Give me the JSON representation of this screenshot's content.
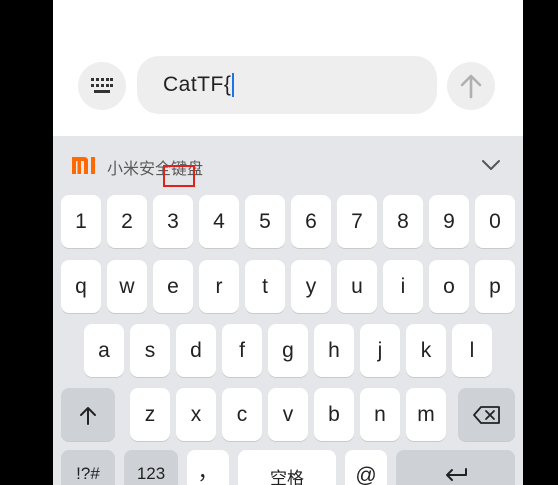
{
  "input": {
    "value": "CatTF{"
  },
  "keyboard": {
    "title": "小米安全键盘",
    "rows": {
      "numbers": [
        "1",
        "2",
        "3",
        "4",
        "5",
        "6",
        "7",
        "8",
        "9",
        "0"
      ],
      "row1": [
        "q",
        "w",
        "e",
        "r",
        "t",
        "y",
        "u",
        "i",
        "o",
        "p"
      ],
      "row2": [
        "a",
        "s",
        "d",
        "f",
        "g",
        "h",
        "j",
        "k",
        "l"
      ],
      "row3": [
        "z",
        "x",
        "c",
        "v",
        "b",
        "n",
        "m"
      ]
    },
    "bottom": {
      "symbols": "!?#",
      "numbers": "123",
      "comma": "，",
      "space": "空格",
      "at": "@"
    }
  },
  "colors": {
    "brand": "#ff6900",
    "caret": "#1a73e8",
    "highlight": "#e0211c"
  },
  "icons": [
    "keyboard-icon",
    "arrow-up-icon",
    "xiaomi-logo",
    "chevron-down-icon",
    "shift-icon",
    "backspace-icon",
    "enter-icon"
  ]
}
